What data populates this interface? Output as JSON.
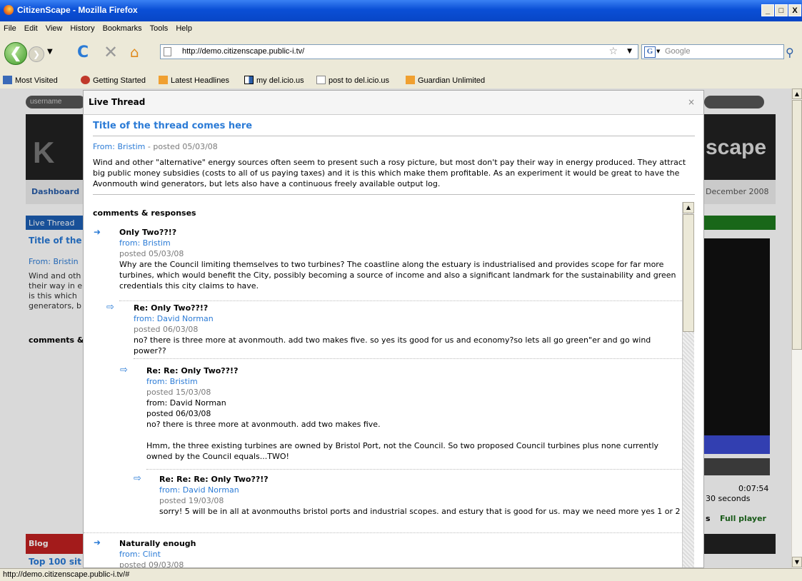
{
  "browser": {
    "window_title": "CitizenScape - Mozilla Firefox",
    "menu": [
      "File",
      "Edit",
      "View",
      "History",
      "Bookmarks",
      "Tools",
      "Help"
    ],
    "url": "http://demo.citizenscape.public-i.tv/",
    "search_engine": "Google",
    "search_placeholder": "Google",
    "bookmarks": [
      "Most Visited",
      "Getting Started",
      "Latest Headlines",
      "my del.icio.us",
      "post to del.icio.us",
      "Guardian Unlimited"
    ],
    "status_text": "http://demo.citizenscape.public-i.tv/#",
    "win_buttons": [
      "_",
      "□",
      "X"
    ]
  },
  "background_page": {
    "username_placeholder": "username",
    "dashboard": "Dashboard",
    "live_thread": "Live Thread",
    "title_fragment": "Title of the",
    "from_fragment": "From: Bristin",
    "body_fragments": [
      "Wind and oth",
      "their way in e",
      "is this which",
      "generators, b"
    ],
    "comments_fragment": "comments &",
    "blog": "Blog",
    "top_sites": "Top 100 sit",
    "brand_fragment": "scape",
    "date_fragment": "December 2008",
    "time": "0:07:54",
    "seconds": "30 seconds",
    "full_player": "Full player",
    "player_s": "s"
  },
  "modal": {
    "header": "Live Thread",
    "close": "×",
    "thread_title": "Title of the thread comes here",
    "thread_from_name": "From: Bristim",
    "thread_posted": " - posted 05/03/08",
    "thread_body": "Wind and other \"alternative\" energy sources often seem to present such a rosy picture, but most don't pay their way in energy produced. They attract big public money subsidies (costs to all of us paying taxes) and it is this which make them profitable. As an experiment it would be great to have the Avonmouth wind generators, but lets also have a continuous freely available output log.",
    "comments_heading": "comments & responses",
    "comments": [
      {
        "subject": "Only Two??!?",
        "from": "from: Bristim",
        "posted": "posted 05/03/08",
        "body": "Why are the Council limiting themselves to two turbines? The coastline along the estuary is industrialised and provides scope for far more turbines, which would benefit the City, possibly becoming a source of income and also a significant landmark for the sustainability and green credentials this city claims to have."
      },
      {
        "subject": "Re: Only Two??!?",
        "from": "from: David Norman",
        "posted": "posted 06/03/08",
        "body": "no? there is three more at avonmouth. add two makes five. so yes its good for us and economy?so lets all go green\"er and go wind power??"
      },
      {
        "subject": "Re: Re: Only Two??!?",
        "from": "from: Bristim",
        "posted": "posted 15/03/08",
        "quote_from": "from: David Norman",
        "quote_posted": "posted 06/03/08",
        "quote_body": "no? there is three more at avonmouth. add two makes five.",
        "body": "Hmm, the three existing turbines are owned by Bristol Port, not the Council. So two proposed Council turbines plus none currently owned by the Council equals...TWO!"
      },
      {
        "subject": "Re: Re: Re: Only Two??!?",
        "from": "from: David Norman",
        "posted": "posted 19/03/08",
        "body": "sorry! 5 will be in all at avonmouths bristol ports and industrial scopes. and estury that is good for us. may we need more yes 1 or 2"
      },
      {
        "subject": "Naturally enough",
        "from": "from: Clint",
        "posted": "posted 09/03/08"
      }
    ]
  },
  "colors": {
    "link_blue": "#2b7bd6",
    "titlebar_blue": "#0a4fd6",
    "green_bar": "#1e7a1e",
    "red_bar": "#c02020"
  }
}
